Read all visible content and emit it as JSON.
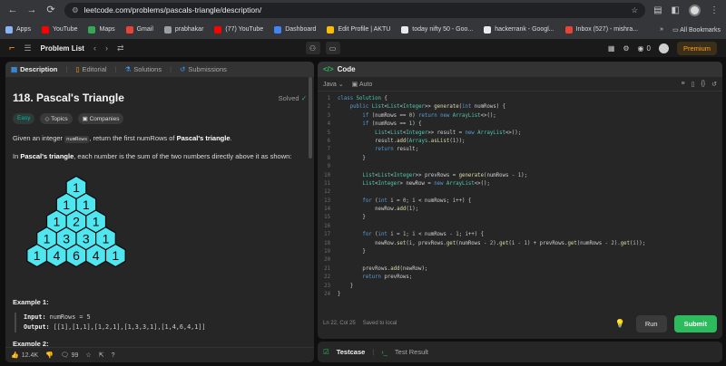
{
  "browser": {
    "url": "leetcode.com/problems/pascals-triangle/description/",
    "bookmarks": [
      {
        "label": "Apps",
        "color": "#8ab4f8"
      },
      {
        "label": "YouTube",
        "color": "#ff0000"
      },
      {
        "label": "Maps",
        "color": "#34a853"
      },
      {
        "label": "Gmail",
        "color": "#ea4335"
      },
      {
        "label": "prabhakar",
        "color": "#9aa0a6"
      },
      {
        "label": "(77) YouTube",
        "color": "#ff0000"
      },
      {
        "label": "Dashboard",
        "color": "#4285f4"
      },
      {
        "label": "Edit Profile | AKTU",
        "color": "#fbbc04"
      },
      {
        "label": "today nifty 50 - Goo...",
        "color": "#e8eaed"
      },
      {
        "label": "hackerrank - Googl...",
        "color": "#e8eaed"
      },
      {
        "label": "Inbox (527) - mishra...",
        "color": "#ea4335"
      }
    ],
    "all_bookmarks": "All Bookmarks"
  },
  "topbar": {
    "problem_list": "Problem List",
    "coins": "0",
    "premium": "Premium"
  },
  "tabs": {
    "description": "Description",
    "editorial": "Editorial",
    "solutions": "Solutions",
    "submissions": "Submissions"
  },
  "problem": {
    "title": "118. Pascal's Triangle",
    "status": "Solved",
    "difficulty": "Easy",
    "topics": "Topics",
    "companies": "Companies",
    "desc1_pre": "Given an integer ",
    "desc1_code": "numRows",
    "desc1_mid": ", return the first numRows of ",
    "desc1_bold": "Pascal's triangle",
    "desc1_end": ".",
    "desc2_pre": "In ",
    "desc2_bold": "Pascal's triangle",
    "desc2_end": ", each number is the sum of the two numbers directly above it as shown:",
    "triangle": [
      [
        1
      ],
      [
        1,
        1
      ],
      [
        1,
        2,
        1
      ],
      [
        1,
        3,
        3,
        1
      ],
      [
        1,
        4,
        6,
        4,
        1
      ]
    ],
    "example1_title": "Example 1:",
    "input_label": "Input:",
    "input_value": "numRows = 5",
    "output_label": "Output:",
    "output_value": "[[1],[1,1],[1,2,1],[1,3,3,1],[1,4,6,4,1]]",
    "example2_title": "Example 2:"
  },
  "footer": {
    "likes": "12.4K",
    "comments": "99"
  },
  "editor": {
    "title": "Code",
    "language": "Java",
    "autosave": "Auto",
    "cursor": "Ln 22, Col 25",
    "saved": "Saved to local",
    "run": "Run",
    "submit": "Submit",
    "lines": [
      "class Solution {",
      "    public List<List<Integer>> generate(int numRows) {",
      "        if (numRows == 0) return new ArrayList<>();",
      "        if (numRows == 1) {",
      "            List<List<Integer>> result = new ArrayList<>();",
      "            result.add(Arrays.asList(1));",
      "            return result;",
      "        }",
      "",
      "        List<List<Integer>> prevRows = generate(numRows - 1);",
      "        List<Integer> newRow = new ArrayList<>();",
      "",
      "        for (int i = 0; i < numRows; i++) {",
      "            newRow.add(1);",
      "        }",
      "",
      "        for (int i = 1; i < numRows - 1; i++) {",
      "            newRow.set(i, prevRows.get(numRows - 2).get(i - 1) + prevRows.get(numRows - 2).get(i));",
      "        }",
      "",
      "        prevRows.add(newRow);",
      "        return prevRows;",
      "    }",
      "}"
    ]
  },
  "bottom_tabs": {
    "testcase": "Testcase",
    "test_result": "Test Result"
  },
  "colors": {
    "accent": "#ffa116",
    "hex_fill": "#4fe6f0",
    "submit": "#2cbb5d"
  }
}
